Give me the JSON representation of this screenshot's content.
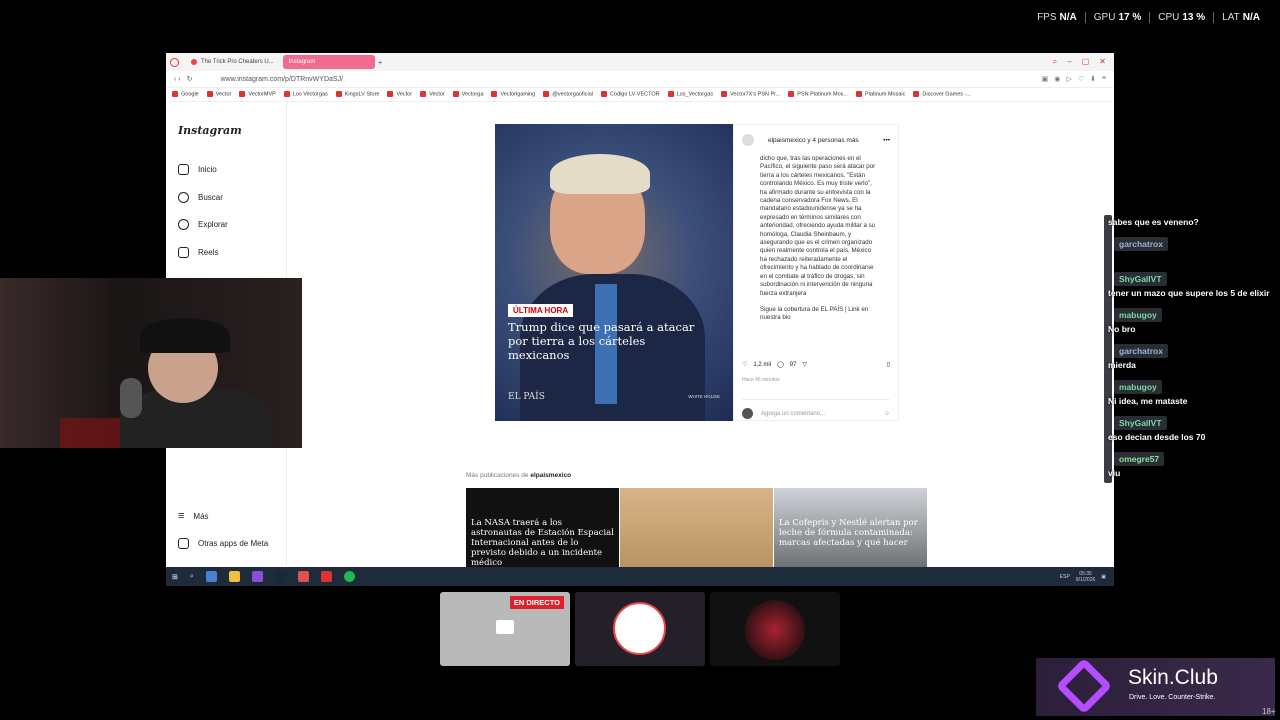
{
  "stats": {
    "fps_label": "FPS",
    "fps_value": "N/A",
    "gpu_label": "GPU",
    "gpu_value": "17 %",
    "cpu_label": "CPU",
    "cpu_value": "13 %",
    "lat_label": "LAT",
    "lat_value": "N/A"
  },
  "browser": {
    "tabs": [
      "The Trick Pro Cheaters U...",
      "Instagram"
    ],
    "url": "www.instagram.com/p/DTRnvWYDaSJ/",
    "bookmarks": [
      "Google",
      "Vector",
      "VectorMVP",
      "Los Vectorgas",
      "KingsLV Store",
      "Vector",
      "Vector",
      "Vectorga",
      "Vectorlgaming",
      "@vectorgaoficial",
      "Codigo LV-VECTOR",
      "Los_Vectorgas",
      "Vector7X's PSN Pr...",
      "PSN Platinum Mos...",
      "Platinum Mosaic",
      "Discover Games -..."
    ]
  },
  "instagram": {
    "logo": "Instagram",
    "nav": {
      "inicio": "Inicio",
      "buscar": "Buscar",
      "explorar": "Explorar",
      "reels": "Reels",
      "mas": "Más",
      "otras": "Otras apps de Meta"
    },
    "post": {
      "badge": "ÚLTIMA HORA",
      "headline": "Trump dice que pasará a atacar por tierra a los cárteles mexicanos",
      "brand": "EL PAÍS",
      "credit": "WHITE HOUSE",
      "author": "elpaismexico y 4 personas más",
      "caption": "dicho que, tras las operaciones en el Pacífico, el siguiente paso será atacar por tierra a los cárteles mexicanos. \"Están controlando México. Es muy triste verlo\", ha afirmado durante su entrevista con la cadena conservadora Fox News. El mandatario estadounidense ya se ha expresado en términos similares con anterioridad, ofreciendo ayuda militar a su homóloga, Claudia Sheinbaum, y asegurando que es el crimen organizado quien realmente controla el país. México ha rechazado reiteradamente el ofrecimiento y ha hablado de coordinarse en el combate al tráfico de drogas, sin subordinación ni intervención de ninguna fuerza extranjera",
      "caption2": "Sigue la cobertura de EL PAÍS | Link en nuestra bio",
      "likes": "1,2 mil",
      "comments": "97",
      "time": "Hace 46 minutos",
      "comment_placeholder": "Agrega un comentario..."
    },
    "more_prefix": "Más publicaciones de",
    "more_user": "elpaismexico",
    "thumbs": [
      "La NASA traerá a los astronautas de Estación Espacial Internacional antes de lo previsto debido a un incidente médico",
      "",
      "La Cofepris y Nestlé alertan por leche de fórmula contaminada: marcas afectadas y qué hacer"
    ]
  },
  "taskbar": {
    "lang": "ESP",
    "time": "05:35",
    "date": "9/1/2026"
  },
  "chat": [
    {
      "type": "msg",
      "text": "sabes que es veneno?"
    },
    {
      "type": "user",
      "name": "garchatrox",
      "cls": "u-gar"
    },
    {
      "type": "user",
      "name": "ShyGallVT",
      "cls": "u-shy"
    },
    {
      "type": "msg",
      "text": "tener un mazo que supere los 5 de elixir"
    },
    {
      "type": "user",
      "name": "mabugoy",
      "cls": "u-mab"
    },
    {
      "type": "msg",
      "text": "No bro"
    },
    {
      "type": "user",
      "name": "garchatrox",
      "cls": "u-gar"
    },
    {
      "type": "msg",
      "text": "mierda"
    },
    {
      "type": "user",
      "name": "mabugoy",
      "cls": "u-mab"
    },
    {
      "type": "msg",
      "text": "Ni idea, me mataste"
    },
    {
      "type": "user",
      "name": "ShyGallVT",
      "cls": "u-shy"
    },
    {
      "type": "msg",
      "text": "eso decian desde los 70"
    },
    {
      "type": "user",
      "name": "omegre57",
      "cls": "u-ome"
    },
    {
      "type": "msg",
      "text": "viu"
    }
  ],
  "live_label": "EN DIRECTO",
  "ad": {
    "brand": "Skin.Club",
    "tagline": "Drive. Love. Counter-Strike.",
    "age": "18+"
  }
}
